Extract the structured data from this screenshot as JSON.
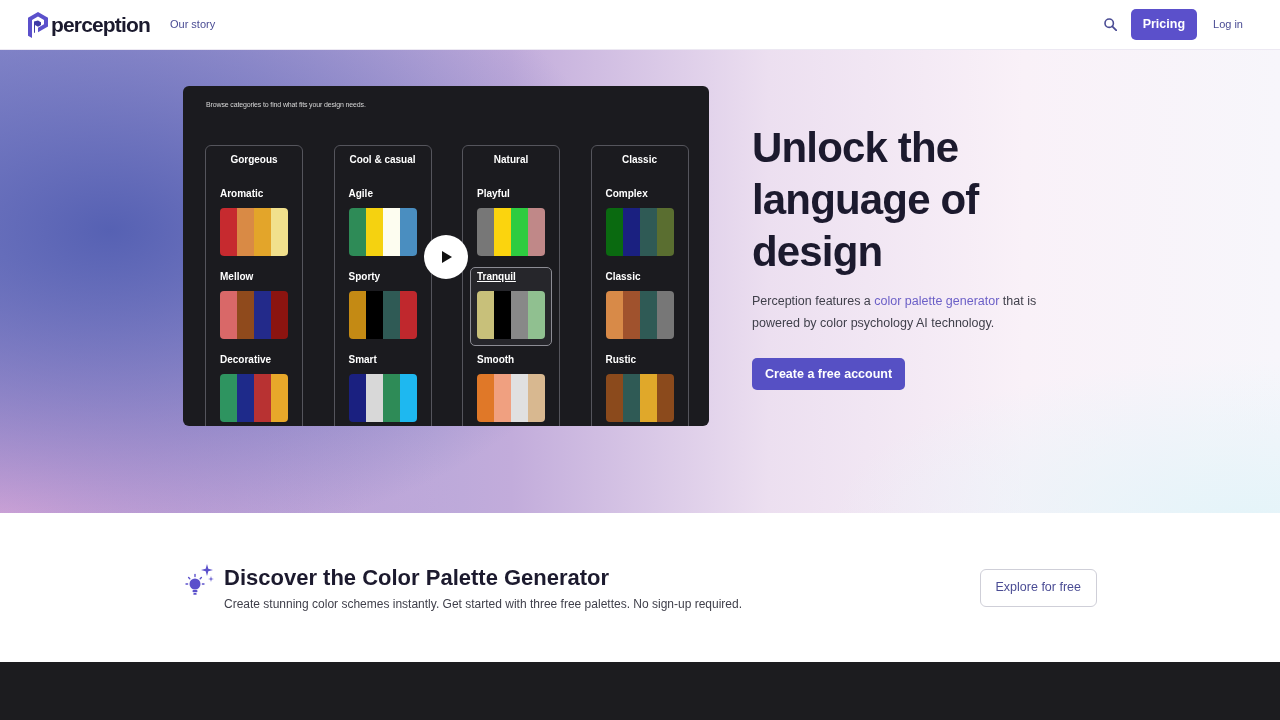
{
  "header": {
    "logo_text": "perception",
    "nav_links": [
      {
        "label": "Our story"
      }
    ],
    "pricing_button": "Pricing",
    "login_link": "Log in"
  },
  "hero": {
    "video": {
      "subtitle": "Browse categories to find what fits your design needs.",
      "categories": [
        {
          "title": "Gorgeous",
          "palettes": [
            {
              "name": "Aromatic",
              "selected": false,
              "swatches": [
                {
                  "color": "#c62a2f"
                },
                {
                  "color": "#d98a45"
                },
                {
                  "color": "#e3a52a"
                },
                {
                  "color": "#f1e08c"
                }
              ]
            },
            {
              "name": "Mellow",
              "selected": false,
              "swatches": [
                {
                  "color": "#d96868"
                },
                {
                  "color": "#8f4a1c"
                },
                {
                  "color": "#232a8a"
                },
                {
                  "color": "#8b1410"
                }
              ]
            },
            {
              "name": "Decorative",
              "selected": false,
              "swatches": [
                {
                  "color": "#2e9460"
                },
                {
                  "color": "#1e2a8a"
                },
                {
                  "color": "#b83232"
                },
                {
                  "color": "#e8a82a"
                }
              ]
            }
          ]
        },
        {
          "title": "Cool & casual",
          "palettes": [
            {
              "name": "Agile",
              "selected": false,
              "swatches": [
                {
                  "color": "#2e8b57"
                },
                {
                  "color": "#f5d210"
                },
                {
                  "color": "#fdfdf0"
                },
                {
                  "color": "#4a8ec0"
                }
              ]
            },
            {
              "name": "Sporty",
              "selected": false,
              "swatches": [
                {
                  "color": "#c48a14"
                },
                {
                  "color": "#000000"
                },
                {
                  "color": "#2f5a55"
                },
                {
                  "color": "#c0282d"
                }
              ]
            },
            {
              "name": "Smart",
              "selected": false,
              "swatches": [
                {
                  "color": "#1a2080"
                },
                {
                  "color": "#d8d8d8"
                },
                {
                  "color": "#2e8b57"
                },
                {
                  "color": "#1eb8f0"
                }
              ]
            }
          ]
        },
        {
          "title": "Natural",
          "palettes": [
            {
              "name": "Playful",
              "selected": false,
              "swatches": [
                {
                  "color": "#777777"
                },
                {
                  "color": "#fbd40e"
                },
                {
                  "color": "#2ecc40"
                },
                {
                  "color": "#c08888"
                }
              ]
            },
            {
              "name": "Tranquil",
              "selected": true,
              "swatches": [
                {
                  "color": "#c8c07a"
                },
                {
                  "color": "#000000"
                },
                {
                  "color": "#888888"
                },
                {
                  "color": "#90c090"
                }
              ]
            },
            {
              "name": "Smooth",
              "selected": false,
              "swatches": [
                {
                  "color": "#e07828"
                },
                {
                  "color": "#f0a080"
                },
                {
                  "color": "#e0e0e0"
                },
                {
                  "color": "#d8b890"
                }
              ]
            }
          ]
        },
        {
          "title": "Classic",
          "palettes": [
            {
              "name": "Complex",
              "selected": false,
              "swatches": [
                {
                  "color": "#0a6a10"
                },
                {
                  "color": "#1a2080"
                },
                {
                  "color": "#2f5a55"
                },
                {
                  "color": "#5a6e30"
                }
              ]
            },
            {
              "name": "Classic",
              "selected": false,
              "swatches": [
                {
                  "color": "#d88a48"
                },
                {
                  "color": "#a0522d"
                },
                {
                  "color": "#2f5a55"
                },
                {
                  "color": "#777777"
                }
              ]
            },
            {
              "name": "Rustic",
              "selected": false,
              "swatches": [
                {
                  "color": "#8b4a1c"
                },
                {
                  "color": "#2f5a55"
                },
                {
                  "color": "#e0a82a"
                },
                {
                  "color": "#8b4a1c"
                }
              ]
            }
          ]
        }
      ]
    },
    "heading": "Unlock the language of design",
    "description": {
      "before": "Perception features a ",
      "link": "color palette generator",
      "after": " that is powered by color psychology AI technology."
    },
    "cta_button": "Create a free account"
  },
  "discover": {
    "heading": "Discover the Color Palette Generator",
    "subtitle": "Create stunning color schemes instantly. Get started with three free palettes. No sign-up required.",
    "button": "Explore for free"
  }
}
